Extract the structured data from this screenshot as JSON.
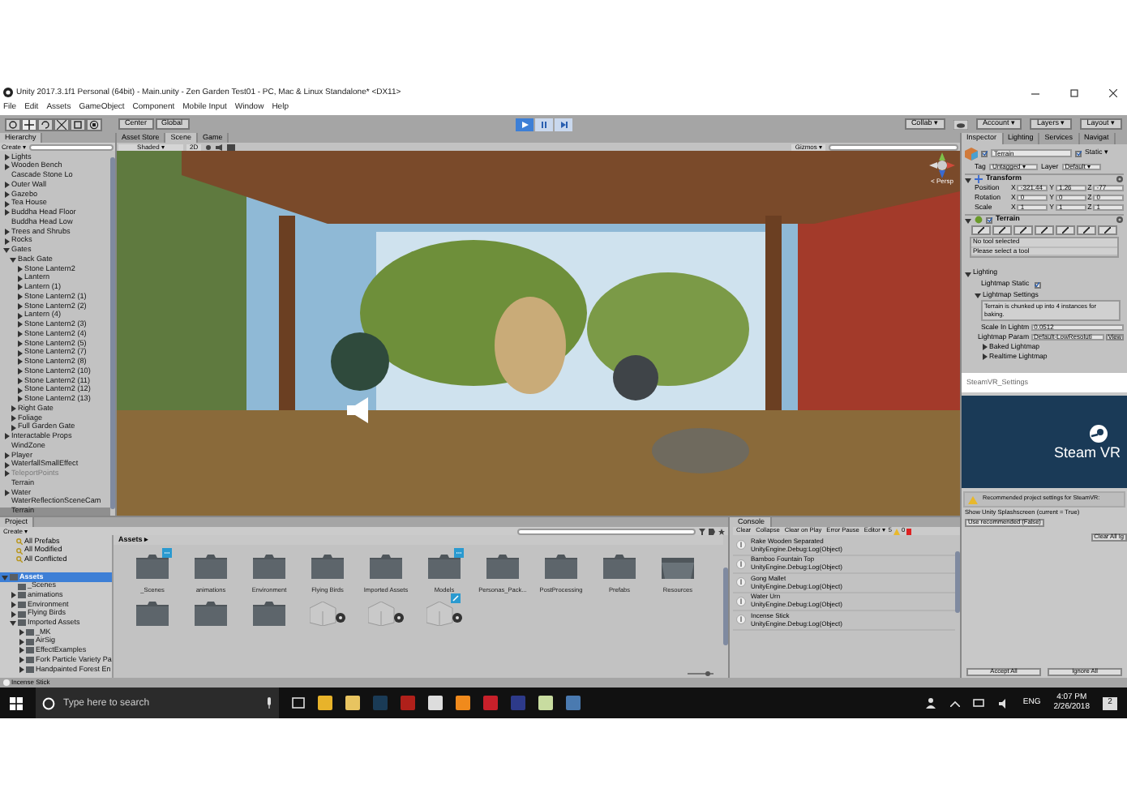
{
  "window": {
    "title": "Unity 2017.3.1f1 Personal (64bit) - Main.unity - Zen Garden Test01 - PC, Mac & Linux Standalone* <DX11>"
  },
  "menu": [
    "File",
    "Edit",
    "Assets",
    "GameObject",
    "Component",
    "Mobile Input",
    "Window",
    "Help"
  ],
  "toolbar": {
    "tools": [
      {
        "selected": false
      },
      {
        "selected": true
      },
      {
        "selected": false
      },
      {
        "selected": false
      },
      {
        "selected": false
      },
      {
        "selected": false
      }
    ],
    "pivot": [
      "Center",
      "Global"
    ],
    "right": [
      "Collab ▾",
      "Account ▾",
      "Layers ▾",
      "Layout ▾"
    ]
  },
  "hierarchy": {
    "tab": "Hierarchy",
    "create": "Create ▾",
    "items": [
      {
        "name": "Lights",
        "expanded": false,
        "selected": false,
        "disabled": false
      },
      {
        "name": "Wooden Bench",
        "expanded": false,
        "selected": false,
        "disabled": false
      },
      {
        "name": "Cascade Stone Lo",
        "selected": false,
        "disabled": false
      },
      {
        "name": "Outer Wall",
        "expanded": false,
        "selected": false,
        "disabled": false
      },
      {
        "name": "Gazebo",
        "expanded": false,
        "selected": false,
        "disabled": false
      },
      {
        "name": "Tea House",
        "expanded": false,
        "selected": false,
        "disabled": false
      },
      {
        "name": "Buddha Head Floor",
        "expanded": false,
        "selected": false,
        "disabled": false
      },
      {
        "name": "Buddha Head Low",
        "selected": false,
        "disabled": false
      },
      {
        "name": "Trees and Shrubs",
        "expanded": false,
        "selected": false,
        "disabled": false
      },
      {
        "name": "Rocks",
        "expanded": false,
        "selected": false,
        "disabled": false
      },
      {
        "name": "Gates",
        "expanded": true,
        "selected": false,
        "disabled": false,
        "children": [
          {
            "name": "Back Gate",
            "expanded": true,
            "selected": false,
            "disabled": false,
            "children": [
              {
                "name": "Stone Lantern2",
                "expanded": false,
                "selected": false,
                "disabled": false
              },
              {
                "name": "Lantern",
                "expanded": false,
                "selected": false,
                "disabled": false
              },
              {
                "name": "Lantern (1)",
                "expanded": false,
                "selected": false,
                "disabled": false
              },
              {
                "name": "Stone Lantern2 (1)",
                "expanded": false,
                "selected": false,
                "disabled": false
              },
              {
                "name": "Stone Lantern2 (2)",
                "expanded": false,
                "selected": false,
                "disabled": false
              },
              {
                "name": "Lantern (4)",
                "expanded": false,
                "selected": false,
                "disabled": false
              },
              {
                "name": "Stone Lantern2 (3)",
                "expanded": false,
                "selected": false,
                "disabled": false
              },
              {
                "name": "Stone Lantern2 (4)",
                "expanded": false,
                "selected": false,
                "disabled": false
              },
              {
                "name": "Stone Lantern2 (5)",
                "expanded": false,
                "selected": false,
                "disabled": false
              },
              {
                "name": "Stone Lantern2 (7)",
                "expanded": false,
                "selected": false,
                "disabled": false
              },
              {
                "name": "Stone Lantern2 (8)",
                "expanded": false,
                "selected": false,
                "disabled": false
              },
              {
                "name": "Stone Lantern2 (10)",
                "expanded": false,
                "selected": false,
                "disabled": false
              },
              {
                "name": "Stone Lantern2 (11)",
                "expanded": false,
                "selected": false,
                "disabled": false
              },
              {
                "name": "Stone Lantern2 (12)",
                "expanded": false,
                "selected": false,
                "disabled": false
              },
              {
                "name": "Stone Lantern2 (13)",
                "expanded": false,
                "selected": false,
                "disabled": false
              }
            ]
          },
          {
            "name": "Right Gate",
            "expanded": false,
            "selected": false,
            "disabled": false
          },
          {
            "name": "Foliage",
            "expanded": false,
            "selected": false,
            "disabled": false
          },
          {
            "name": "Full Garden Gate",
            "expanded": false,
            "selected": false,
            "disabled": false
          }
        ]
      },
      {
        "name": "Interactable Props",
        "expanded": false,
        "selected": false,
        "disabled": false
      },
      {
        "name": "WindZone",
        "selected": false,
        "disabled": false
      },
      {
        "name": "Player",
        "expanded": false,
        "selected": false,
        "disabled": false
      },
      {
        "name": "WaterfallSmallEffect",
        "expanded": false,
        "selected": false,
        "disabled": false
      },
      {
        "name": "TeleportPoints",
        "expanded": false,
        "selected": false,
        "disabled": true
      },
      {
        "name": "Terrain",
        "selected": false,
        "disabled": false
      },
      {
        "name": "Water",
        "expanded": false,
        "selected": false,
        "disabled": false
      },
      {
        "name": "WaterReflectionSceneCam",
        "selected": false,
        "disabled": false
      },
      {
        "name": "Terrain",
        "selected": true,
        "disabled": false
      }
    ]
  },
  "scene": {
    "tabs": [
      {
        "label": "Asset Store",
        "selected": false
      },
      {
        "label": "Scene",
        "selected": true
      },
      {
        "label": "Game",
        "selected": false
      }
    ],
    "shading": "Shaded ▾",
    "mode_2d": "2D",
    "gizmos": "Gizmos ▾",
    "persp": "< Persp"
  },
  "inspector": {
    "tabs": [
      {
        "label": "Inspector",
        "selected": true
      },
      {
        "label": "Lighting",
        "selected": false
      },
      {
        "label": "Services",
        "selected": false
      },
      {
        "label": "Navigat",
        "selected": false
      }
    ],
    "object": {
      "name": "Terrain",
      "active": true,
      "static": true,
      "static_label": "Static ▾",
      "tag_label": "Tag",
      "tag": "Untagged ▾",
      "layer_label": "Layer",
      "layer": "Default ▾"
    },
    "transform": {
      "title": "Transform",
      "rows": [
        {
          "label": "Position",
          "fields": [
            {
              "axis": "X",
              "value": "-321.44"
            },
            {
              "axis": "Y",
              "value": "1.26"
            },
            {
              "axis": "Z",
              "value": "-77"
            }
          ]
        },
        {
          "label": "Rotation",
          "fields": [
            {
              "axis": "X",
              "value": "0"
            },
            {
              "axis": "Y",
              "value": "0"
            },
            {
              "axis": "Z",
              "value": "0"
            }
          ]
        },
        {
          "label": "Scale",
          "fields": [
            {
              "axis": "X",
              "value": "1"
            },
            {
              "axis": "Y",
              "value": "1"
            },
            {
              "axis": "Z",
              "value": "1"
            }
          ]
        }
      ]
    },
    "terrain": {
      "title": "Terrain",
      "enabled": true,
      "tools": [
        {
          "selected": false
        },
        {
          "selected": false
        },
        {
          "selected": false
        },
        {
          "selected": false
        },
        {
          "selected": false
        },
        {
          "selected": false
        },
        {
          "selected": false
        }
      ],
      "help": [
        "No tool selected",
        "Please select a tool"
      ],
      "lighting": "Lighting",
      "lightmap_static_label": "Lightmap Static",
      "lightmap_static": true,
      "lightmap_settings": "Lightmap Settings",
      "info": "Terrain is chunked up into 4 instances for baking.",
      "scale_label": "Scale In Lightm",
      "scale": "0.0512",
      "params_label": "Lightmap Param",
      "params": "Default-LowResoluti",
      "view": "View",
      "foldouts": [
        "Baked Lightmap",
        "Realtime Lightmap"
      ]
    }
  },
  "steamvr": {
    "title": "SteamVR_Settings",
    "logo": "Steam VR",
    "message": "Recommended project settings for SteamVR:",
    "setting": "Show Unity Splashscreen (current = True)",
    "use": "Use recommended (False)",
    "clear": "Clear All Ig",
    "accept": "Accept All",
    "ignore_all": "Ignore All"
  },
  "project": {
    "tab": "Project",
    "create": "Create ▾",
    "favorites": [
      "All Prefabs",
      "All Modified",
      "All Conflicted"
    ],
    "tree": [
      {
        "name": "Assets",
        "expanded": true,
        "selected": true,
        "children": [
          {
            "name": "_Scenes",
            "selected": false
          },
          {
            "name": "animations",
            "expanded": false,
            "selected": false
          },
          {
            "name": "Environment",
            "expanded": false,
            "selected": false
          },
          {
            "name": "Flying Birds",
            "expanded": false,
            "selected": false
          },
          {
            "name": "Imported Assets",
            "expanded": true,
            "selected": false,
            "children": [
              {
                "name": "_MK",
                "expanded": false,
                "selected": false
              },
              {
                "name": "AirSig",
                "expanded": false,
                "selected": false
              },
              {
                "name": "EffectExamples",
                "expanded": false,
                "selected": false
              },
              {
                "name": "Fork Particle Variety Pa",
                "expanded": false,
                "selected": false
              },
              {
                "name": "Handpainted Forest En",
                "expanded": false,
                "selected": false
              }
            ]
          }
        ]
      }
    ],
    "breadcrumb": "Assets ▸",
    "items": [
      {
        "kind": "folder",
        "label": "_Scenes",
        "synced": true,
        "edited": false
      },
      {
        "kind": "folder",
        "label": "animations",
        "synced": false,
        "edited": false
      },
      {
        "kind": "folder",
        "label": "Environment",
        "synced": false,
        "edited": false
      },
      {
        "kind": "folder",
        "label": "Flying Birds",
        "synced": false,
        "edited": false
      },
      {
        "kind": "folder",
        "label": "Imported Assets",
        "synced": false,
        "edited": false
      },
      {
        "kind": "folder",
        "label": "Models",
        "synced": true,
        "edited": false
      },
      {
        "kind": "folder",
        "label": "Personas_Pack...",
        "synced": false,
        "edited": false
      },
      {
        "kind": "folder",
        "label": "PostProcessing",
        "synced": false,
        "edited": false
      },
      {
        "kind": "folder",
        "label": "Prefabs",
        "synced": false,
        "edited": false
      },
      {
        "kind": "open-folder",
        "label": "Resources",
        "synced": false,
        "edited": false
      },
      {
        "kind": "folder",
        "synced": false,
        "edited": false
      },
      {
        "kind": "folder",
        "synced": false,
        "edited": false
      },
      {
        "kind": "folder",
        "synced": false,
        "edited": false
      },
      {
        "kind": "package",
        "synced": false,
        "edited": false
      },
      {
        "kind": "package",
        "synced": false,
        "edited": false
      },
      {
        "kind": "package",
        "synced": false,
        "edited": true
      }
    ],
    "icon_size": {
      "level": 0.85
    }
  },
  "console": {
    "tab": "Console",
    "buttons": [
      "Clear",
      "Collapse",
      "Clear on Play",
      "Error Pause",
      "Editor ▾"
    ],
    "info_count": "5",
    "warning_count": "0",
    "entries": [
      {
        "title": "Rake Wooden Separated",
        "detail": "UnityEngine.Debug:Log(Object)"
      },
      {
        "title": "Bamboo Fountain Top",
        "detail": "UnityEngine.Debug:Log(Object)"
      },
      {
        "title": "Gong Mallet",
        "detail": "UnityEngine.Debug:Log(Object)"
      },
      {
        "title": "Water Urn",
        "detail": "UnityEngine.Debug:Log(Object)"
      },
      {
        "title": "Incense Stick",
        "detail": "UnityEngine.Debug:Log(Object)"
      }
    ]
  },
  "status_bar": "Incense Stick",
  "taskbar": {
    "search_placeholder": "Type here to search",
    "language": "ENG",
    "time": "4:07 PM",
    "date": "2/26/2018",
    "notifications": "2"
  }
}
